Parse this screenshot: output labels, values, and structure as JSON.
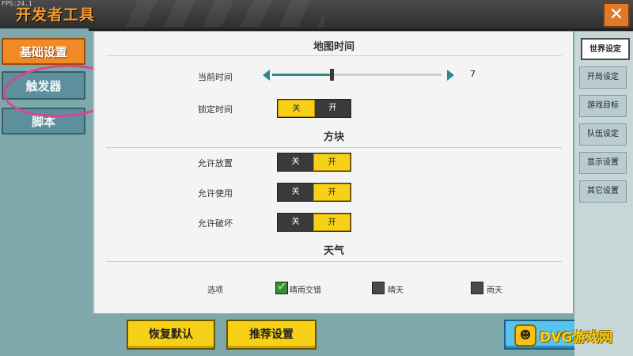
{
  "fps": "FPS:24.1",
  "window": {
    "title": "开发者工具",
    "close_label": "✕"
  },
  "left_nav": {
    "items": [
      {
        "label": "基础设置",
        "active": true
      },
      {
        "label": "触发器",
        "active": false
      },
      {
        "label": "脚本",
        "active": false
      }
    ]
  },
  "main": {
    "map_time": {
      "title": "地图时间",
      "current_time": {
        "label": "当前时间",
        "value": "7",
        "fraction": 0.35
      },
      "lock_time": {
        "label": "锁定时间",
        "off": "关",
        "on": "开",
        "state": "关"
      }
    },
    "blocks": {
      "title": "方块",
      "allow_place": {
        "label": "允许放置",
        "off": "关",
        "on": "开",
        "state": "开"
      },
      "allow_use": {
        "label": "允许使用",
        "off": "关",
        "on": "开",
        "state": "开"
      },
      "allow_break": {
        "label": "允许破坏",
        "off": "关",
        "on": "开",
        "state": "开"
      }
    },
    "weather": {
      "title": "天气",
      "label": "选项",
      "options": [
        {
          "label": "晴雨交错",
          "checked": true
        },
        {
          "label": "晴天",
          "checked": false
        },
        {
          "label": "雨天",
          "checked": false
        }
      ]
    }
  },
  "bottom": {
    "reset_label": "恢复默认",
    "recommend_label": "推荐设置"
  },
  "right_tabs": [
    {
      "label": "世界设定",
      "active": true
    },
    {
      "label": "开局设定",
      "active": false
    },
    {
      "label": "游戏目标",
      "active": false
    },
    {
      "label": "队伍设定",
      "active": false
    },
    {
      "label": "显示设置",
      "active": false
    },
    {
      "label": "其它设置",
      "active": false
    }
  ],
  "watermark": {
    "text": "DVG游戏网"
  },
  "colors": {
    "accent_orange": "#f08a24",
    "toggle_on": "#f7d117",
    "panel_teal": "#7fa8ad",
    "annotation_circle": "#d9468f"
  }
}
